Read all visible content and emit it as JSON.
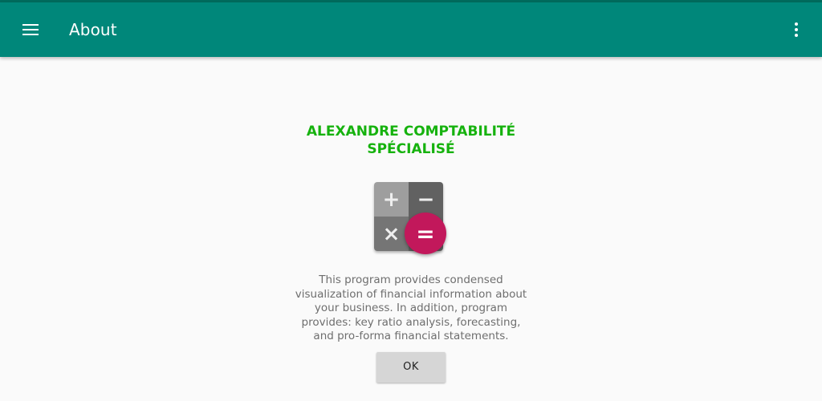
{
  "toolbar": {
    "title": "About",
    "menu_icon": "hamburger-menu-icon",
    "overflow_icon": "more-vert-icon",
    "color": "#00877a"
  },
  "about": {
    "company_name": "ALEXANDRE COMPTABILITÉ SPÉCIALISÉ",
    "company_color": "#16b20e",
    "logo": {
      "icon": "calculator-icon",
      "keys": [
        "+",
        "−",
        "×",
        "="
      ],
      "accent_color": "#c2185b"
    },
    "description": "This program provides condensed visualization of financial information about your business. In addition, program provides: key ratio analysis, forecasting, and pro-forma financial statements.",
    "ok_label": "OK"
  }
}
